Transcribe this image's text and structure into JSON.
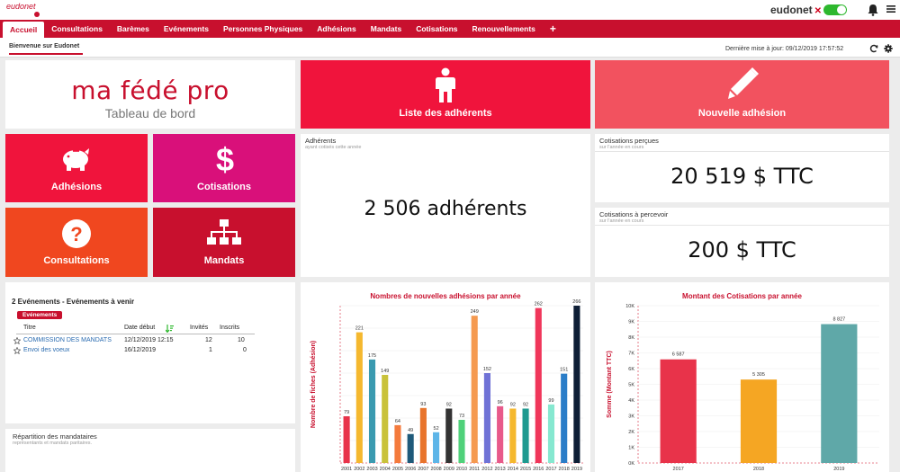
{
  "header": {
    "logo_text": "eudonet",
    "brand": "eudonet",
    "brand_mark": "✕"
  },
  "nav": {
    "items": [
      "Accueil",
      "Consultations",
      "Barèmes",
      "Evénements",
      "Personnes Physiques",
      "Adhésions",
      "Mandats",
      "Cotisations",
      "Renouvellements"
    ],
    "plus": "+"
  },
  "tabbar": {
    "welcome": "Bienvenue sur Eudonet",
    "last_update": "Dernière mise à jour: 09/12/2019 17:57:52"
  },
  "title_tile": {
    "title": "ma fédé pro",
    "subtitle": "Tableau de bord"
  },
  "action_tiles": {
    "list_members": "Liste des adhérents",
    "new_membership": "Nouvelle adhésion",
    "adhesions": "Adhésions",
    "cotisations": "Cotisations",
    "consultations": "Consultations",
    "mandats": "Mandats"
  },
  "colors": {
    "red_dark": "#c8102e",
    "red_bright": "#f0143c",
    "pink_red": "#f2525f",
    "magenta": "#d9107a",
    "orange_red": "#f0471f"
  },
  "stats": {
    "adherents": {
      "title": "Adhérents",
      "subtitle": "ayant cotisés cette année",
      "value": "2 506 adhérents"
    },
    "cotisations_percues": {
      "title": "Cotisations perçues",
      "subtitle": "sur l'année en cours",
      "value": "20 519 $ TTC"
    },
    "cotisations_a_percevoir": {
      "title": "Cotisations à percevoir",
      "subtitle": "sur l'année en cours",
      "value": "200 $ TTC"
    }
  },
  "events": {
    "title": "2 Evénements - Evénements à venir",
    "badge": "Evénements",
    "columns": {
      "titre": "Titre",
      "date": "Date début",
      "invites": "Invités",
      "inscrits": "Inscrits"
    },
    "rows": [
      {
        "titre": "COMMISSION DES MANDATS",
        "date": "12/12/2019 12:15",
        "invites": "12",
        "inscrits": "10"
      },
      {
        "titre": "Envoi des voeux",
        "date": "16/12/2019",
        "invites": "1",
        "inscrits": "0"
      }
    ]
  },
  "repartition": {
    "title": "Répartition des mandataires",
    "subtitle": "représentants et mandats paritaires."
  },
  "chart_data": [
    {
      "type": "bar",
      "title": "Nombres de nouvelles adhésions par année",
      "ylabel": "Nombre de fiches (Adhésion)",
      "categories": [
        "2001",
        "2002",
        "2003",
        "2004",
        "2005",
        "2006",
        "2007",
        "2008",
        "2009",
        "2010",
        "2011",
        "2012",
        "2013",
        "2014",
        "2015",
        "2016",
        "2017",
        "2018",
        "2019"
      ],
      "values": [
        79,
        221,
        175,
        149,
        64,
        49,
        93,
        52,
        92,
        73,
        249,
        152,
        96,
        92,
        92,
        262,
        99,
        151,
        266
      ],
      "colors": [
        "#e8334a",
        "#f5b82e",
        "#3a9ab0",
        "#c9c23a",
        "#f47a3c",
        "#1f5a7a",
        "#e8742c",
        "#5db5e8",
        "#333333",
        "#4fd17a",
        "#f59a50",
        "#6f72d6",
        "#e85a8a",
        "#f5b82e",
        "#1f9a90",
        "#f0365a",
        "#86e8d0",
        "#2a7dc8",
        "#0e1e36"
      ],
      "ylim": [
        0,
        266
      ],
      "grid": true
    },
    {
      "type": "bar",
      "title": "Montant des Cotisations par année",
      "ylabel": "Somme (Montant TTC)",
      "categories": [
        "2017",
        "2018",
        "2019"
      ],
      "values": [
        6587,
        5305,
        8827
      ],
      "labels": [
        "6 587",
        "5 305",
        "8 827"
      ],
      "colors": [
        "#e8334a",
        "#f5a623",
        "#5fa8a8"
      ],
      "ylim": [
        0,
        10000
      ],
      "yticks": [
        "0K",
        "1K",
        "2K",
        "3K",
        "4K",
        "5K",
        "6K",
        "7K",
        "8K",
        "9K",
        "10K"
      ],
      "grid": true
    }
  ]
}
